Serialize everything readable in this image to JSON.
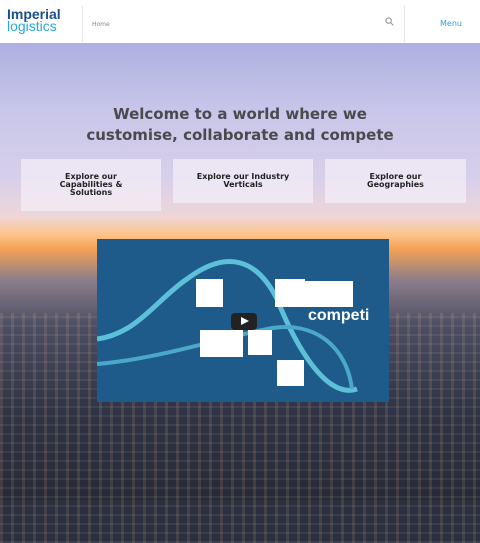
{
  "header": {
    "logo_line1": "Imperial",
    "logo_line2": "logistics",
    "breadcrumb": "Home",
    "menu_label": "Menu"
  },
  "hero": {
    "title_line1": "Welcome to a world where we",
    "title_line2": "customise, collaborate and compete"
  },
  "cards": [
    {
      "label_lines": [
        "Explore our",
        "Capabilities &",
        "Solutions"
      ]
    },
    {
      "label_lines": [
        "Explore our Industry",
        "Verticals"
      ]
    },
    {
      "label_lines": [
        "Explore our",
        "Geographies"
      ]
    }
  ],
  "video": {
    "overlay_text": "competi"
  }
}
